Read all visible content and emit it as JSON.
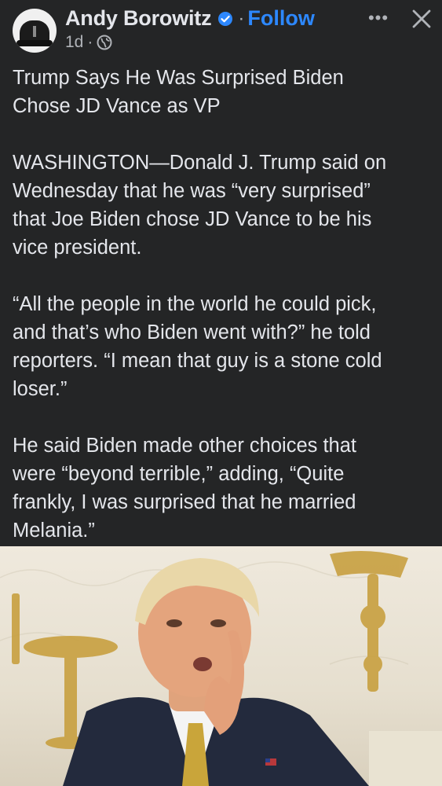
{
  "post": {
    "author": "Andy Borowitz",
    "follow_label": "Follow",
    "separator": "·",
    "timestamp": "1d",
    "more_label": "•••",
    "headline_1": "Trump Says He Was Surprised Biden",
    "headline_2": "Chose JD Vance as VP",
    "p1_1": "WASHINGTON—Donald J. Trump said on",
    "p1_2": "Wednesday that he was “very surprised”",
    "p1_3": "that Joe Biden chose JD Vance to be his",
    "p1_4": "vice president.",
    "p2_1": "“All the people in the world he could pick,",
    "p2_2": "and that’s who Biden went with?” he told",
    "p2_3": "reporters. “I mean that guy is a stone cold",
    "p2_4": "loser.”",
    "p3_1": "He said Biden made other choices that",
    "p3_2": "were “beyond terrible,” adding, “Quite",
    "p3_3": "frankly, I was surprised that he married",
    "p3_4": "Melania.”"
  },
  "icons": {
    "verified": "verified-badge-icon",
    "globe": "globe-icon",
    "more": "more-options-icon",
    "close": "close-icon"
  },
  "colors": {
    "background": "#242526",
    "text": "#e4e6eb",
    "secondary_text": "#b0b3b8",
    "accent": "#2d88ff"
  }
}
